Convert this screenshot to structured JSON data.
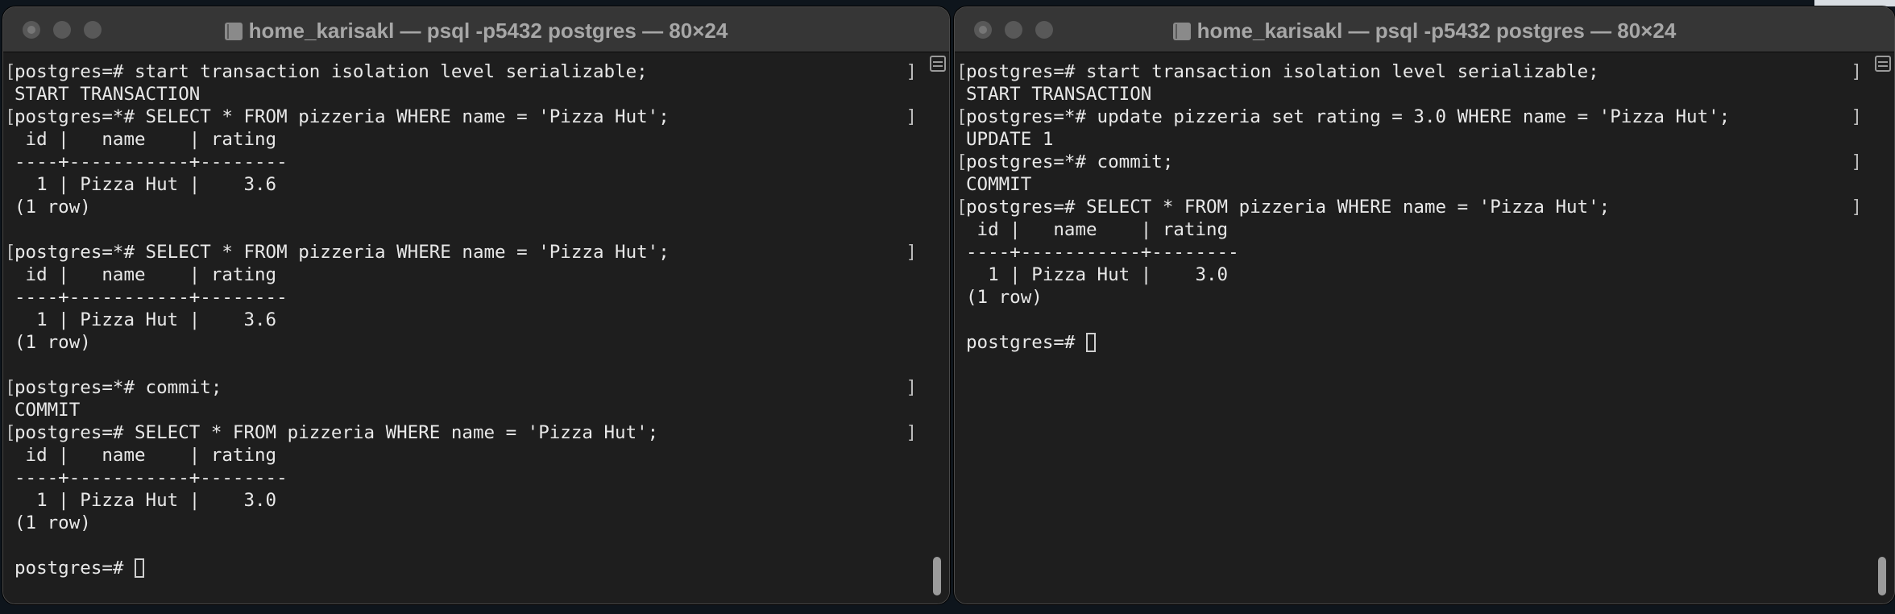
{
  "windows": [
    {
      "title": "home_karisakl — psql -p5432 postgres — 80×24",
      "lines": [
        {
          "text": "postgres=# start transaction isolation level serializable;",
          "marked": true
        },
        {
          "text": "START TRANSACTION",
          "marked": false
        },
        {
          "text": "postgres=*# SELECT * FROM pizzeria WHERE name = 'Pizza Hut';",
          "marked": true
        },
        {
          "text": " id |   name    | rating",
          "marked": false
        },
        {
          "text": "----+-----------+--------",
          "marked": false
        },
        {
          "text": "  1 | Pizza Hut |    3.6",
          "marked": false
        },
        {
          "text": "(1 row)",
          "marked": false
        },
        {
          "text": "",
          "marked": false
        },
        {
          "text": "postgres=*# SELECT * FROM pizzeria WHERE name = 'Pizza Hut';",
          "marked": true
        },
        {
          "text": " id |   name    | rating",
          "marked": false
        },
        {
          "text": "----+-----------+--------",
          "marked": false
        },
        {
          "text": "  1 | Pizza Hut |    3.6",
          "marked": false
        },
        {
          "text": "(1 row)",
          "marked": false
        },
        {
          "text": "",
          "marked": false
        },
        {
          "text": "postgres=*# commit;",
          "marked": true
        },
        {
          "text": "COMMIT",
          "marked": false
        },
        {
          "text": "postgres=# SELECT * FROM pizzeria WHERE name = 'Pizza Hut';",
          "marked": true
        },
        {
          "text": " id |   name    | rating",
          "marked": false
        },
        {
          "text": "----+-----------+--------",
          "marked": false
        },
        {
          "text": "  1 | Pizza Hut |    3.0",
          "marked": false
        },
        {
          "text": "(1 row)",
          "marked": false
        },
        {
          "text": "",
          "marked": false
        },
        {
          "text": "postgres=# ",
          "marked": false,
          "cursor": true
        }
      ]
    },
    {
      "title": "home_karisakl — psql -p5432 postgres — 80×24",
      "lines": [
        {
          "text": "postgres=# start transaction isolation level serializable;",
          "marked": true
        },
        {
          "text": "START TRANSACTION",
          "marked": false
        },
        {
          "text": "postgres=*# update pizzeria set rating = 3.0 WHERE name = 'Pizza Hut';",
          "marked": true
        },
        {
          "text": "UPDATE 1",
          "marked": false
        },
        {
          "text": "postgres=*# commit;",
          "marked": true
        },
        {
          "text": "COMMIT",
          "marked": false
        },
        {
          "text": "postgres=# SELECT * FROM pizzeria WHERE name = 'Pizza Hut';",
          "marked": true
        },
        {
          "text": " id |   name    | rating",
          "marked": false
        },
        {
          "text": "----+-----------+--------",
          "marked": false
        },
        {
          "text": "  1 | Pizza Hut |    3.0",
          "marked": false
        },
        {
          "text": "(1 row)",
          "marked": false
        },
        {
          "text": "",
          "marked": false
        },
        {
          "text": "postgres=# ",
          "marked": false,
          "cursor": true
        }
      ]
    }
  ],
  "icons": {
    "traffic_lights": [
      "close-icon",
      "minimize-icon",
      "zoom-icon"
    ],
    "title_icon": "folder-icon",
    "split_button": "split-pane-icon"
  },
  "colors": {
    "terminal_bg": "#1e1e1e",
    "terminal_fg": "#e8e8e8",
    "titlebar_bg": "#363636",
    "title_text": "#a7a7a7"
  }
}
